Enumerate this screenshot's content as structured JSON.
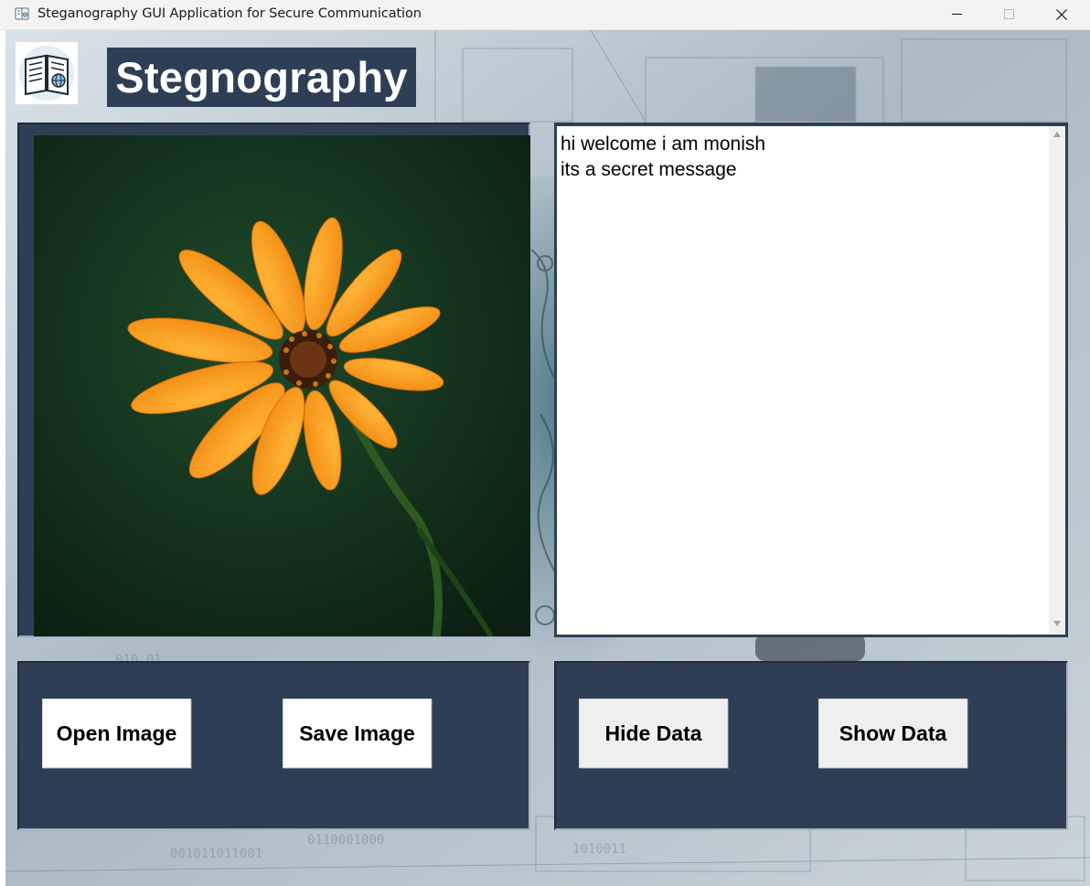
{
  "window": {
    "title": "Steganography GUI Application for Secure Communication"
  },
  "header": {
    "logo_icon": "book-globe-icon",
    "app_title": "Stegnography"
  },
  "image_panel": {
    "preview_subject": "orange-flower-photo"
  },
  "message_panel": {
    "text": "hi welcome i am monish\nits a secret message"
  },
  "controls": {
    "open_image_label": "Open Image",
    "save_image_label": "Save Image",
    "hide_data_label": "Hide Data",
    "show_data_label": "Show Data"
  },
  "colors": {
    "panel_bg": "#2e3f55",
    "title_bar_bg": "#f3f3f3",
    "button_bg": "#ffffff",
    "button_alt_bg": "#efefef"
  }
}
